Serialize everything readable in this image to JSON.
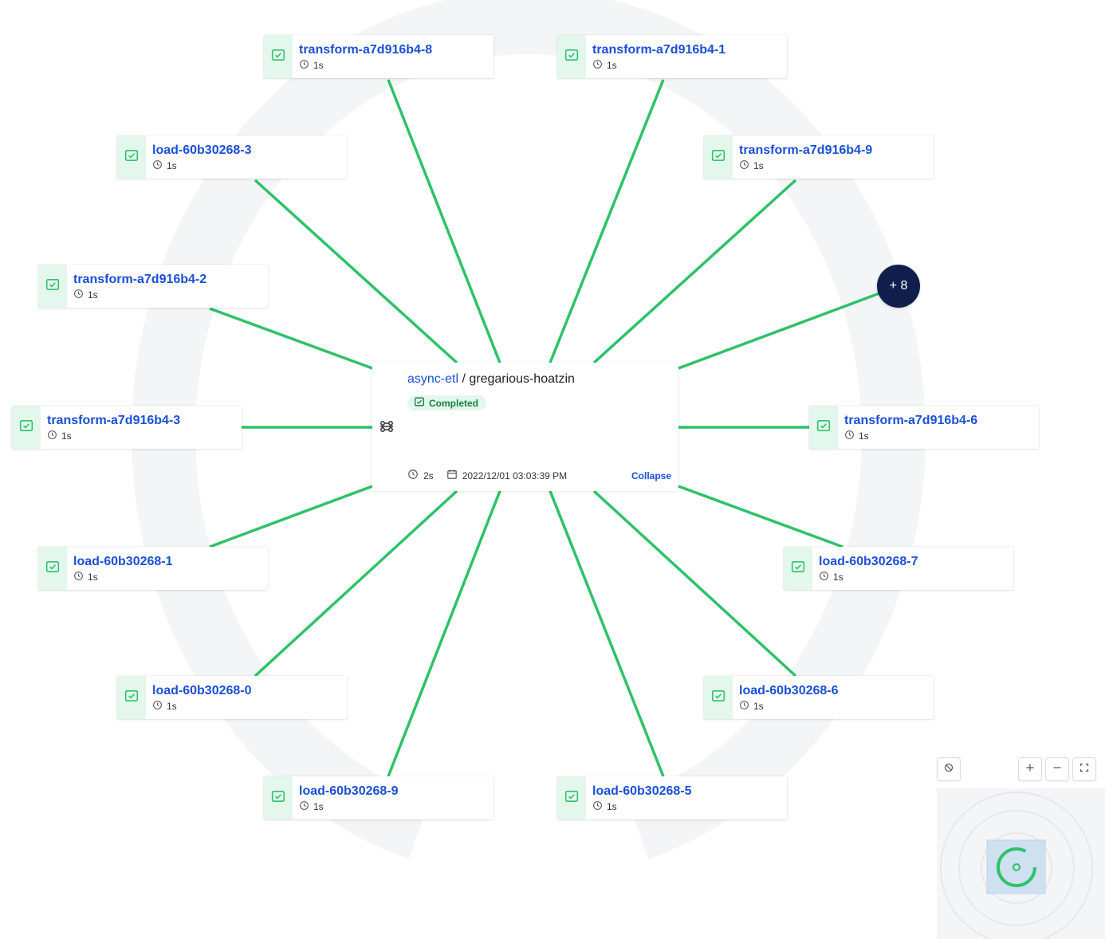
{
  "run": {
    "flow_name": "async-etl",
    "separator": " / ",
    "run_name": "gregarious-hoatzin",
    "status": "Completed",
    "duration": "2s",
    "start_time": "2022/12/01 03:03:39 PM",
    "collapse_label": "Collapse"
  },
  "more_nodes": {
    "label": "+ 8"
  },
  "task_nodes": [
    {
      "name": "transform-a7d916b4-8",
      "duration": "1s",
      "state": "completed"
    },
    {
      "name": "transform-a7d916b4-1",
      "duration": "1s",
      "state": "completed"
    },
    {
      "name": "load-60b30268-3",
      "duration": "1s",
      "state": "completed"
    },
    {
      "name": "transform-a7d916b4-9",
      "duration": "1s",
      "state": "completed"
    },
    {
      "name": "transform-a7d916b4-2",
      "duration": "1s",
      "state": "completed"
    },
    {
      "name": "transform-a7d916b4-3",
      "duration": "1s",
      "state": "completed"
    },
    {
      "name": "transform-a7d916b4-6",
      "duration": "1s",
      "state": "completed"
    },
    {
      "name": "load-60b30268-1",
      "duration": "1s",
      "state": "completed"
    },
    {
      "name": "load-60b30268-7",
      "duration": "1s",
      "state": "completed"
    },
    {
      "name": "load-60b30268-0",
      "duration": "1s",
      "state": "completed"
    },
    {
      "name": "load-60b30268-6",
      "duration": "1s",
      "state": "completed"
    },
    {
      "name": "load-60b30268-9",
      "duration": "1s",
      "state": "completed"
    },
    {
      "name": "load-60b30268-5",
      "duration": "1s",
      "state": "completed"
    }
  ],
  "colors": {
    "edge": "#2ec26a",
    "completed": "#2ec26a",
    "completed_bg": "#e3f7ec",
    "link": "#1a4fd6",
    "bubble": "#0f1e4a",
    "ring": "#f4f5f6"
  },
  "controls": {
    "reset_icon": "ban-icon",
    "zoom_in_icon": "plus-icon",
    "zoom_out_icon": "minus-icon",
    "fit_icon": "fit-screen-icon"
  }
}
